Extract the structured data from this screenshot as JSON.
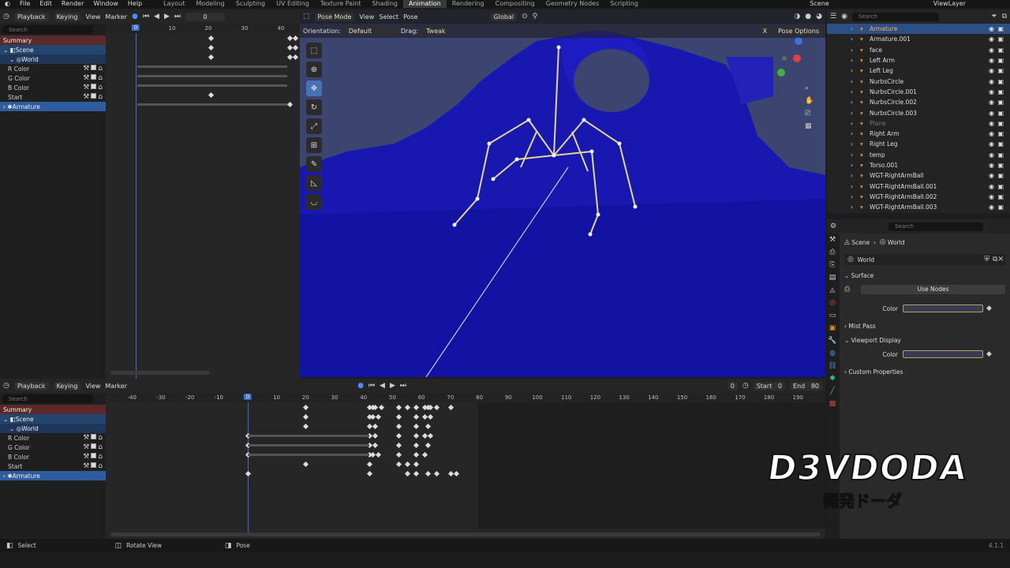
{
  "topbar": {
    "menus": [
      "File",
      "Edit",
      "Render",
      "Window",
      "Help"
    ],
    "workspaces": [
      "Layout",
      "Modeling",
      "Sculpting",
      "UV Editing",
      "Texture Paint",
      "Shading",
      "Animation",
      "Rendering",
      "Compositing",
      "Geometry Nodes",
      "Scripting"
    ],
    "active_workspace": "Animation",
    "scene_name": "Scene",
    "view_layer": "ViewLayer"
  },
  "dopesheet_top": {
    "header": {
      "playback": "Playback",
      "keying": "Keying",
      "view": "View",
      "marker": "Marker",
      "frame": "0"
    },
    "search_placeholder": "Search",
    "channels": [
      "Summary",
      "Scene",
      "World",
      "R Color",
      "G Color",
      "B Color",
      "Start",
      "Armature"
    ],
    "ruler": [
      "0",
      "10",
      "20",
      "30",
      "40"
    ],
    "current_frame": "0"
  },
  "viewport": {
    "mode": "Pose Mode",
    "menus": [
      "View",
      "Select",
      "Pose"
    ],
    "orientation_label": "Orientation:",
    "orientation_value": "Default",
    "drag_label": "Drag:",
    "drag_value": "Tweak",
    "transform_orientation": "Global",
    "pose_options": "Pose Options",
    "close_x": "X"
  },
  "timeline_bottom": {
    "header": {
      "playback": "Playback",
      "keying": "Keying",
      "view": "View",
      "marker": "Marker"
    },
    "frame": "0",
    "start_label": "Start",
    "start_value": "0",
    "end_label": "End",
    "end_value": "80",
    "search_placeholder": "Search",
    "channels": [
      "Summary",
      "Scene",
      "World",
      "R Color",
      "G Color",
      "B Color",
      "Start",
      "Armature"
    ],
    "ruler": [
      "-40",
      "-30",
      "-20",
      "-10",
      "0",
      "10",
      "20",
      "30",
      "40",
      "50",
      "60",
      "70",
      "80",
      "90",
      "100",
      "110",
      "120",
      "130",
      "140",
      "150",
      "160",
      "170",
      "180",
      "190"
    ],
    "current_frame": "0"
  },
  "outliner": {
    "search_placeholder": "Search",
    "items": [
      "Armature",
      "Armature.001",
      "face",
      "Left Arm",
      "Left Leg",
      "NurbsCircle",
      "NurbsCircle.001",
      "NurbsCircle.002",
      "NurbsCircle.003",
      "Plane",
      "Right Arm",
      "Right Leg",
      "temp",
      "Torso.001",
      "WGT-RightArmBall",
      "WGT-RightArmBall.001",
      "WGT-RightArmBall.002",
      "WGT-RightArmBall.003"
    ]
  },
  "properties": {
    "search_placeholder": "Search",
    "breadcrumb": [
      "Scene",
      "World"
    ],
    "datablock": "World",
    "surface": "Surface",
    "use_nodes": "Use Nodes",
    "color_label": "Color",
    "mist_pass": "Mist Pass",
    "viewport_display": "Viewport Display",
    "color_label2": "Color",
    "custom_properties": "Custom Properties"
  },
  "watermark": {
    "title": "D3VDODA",
    "subtitle": "開発ドーダ"
  },
  "status": {
    "select": "Select",
    "rotate": "Rotate View",
    "pose": "Pose",
    "version": "4.1.1"
  }
}
